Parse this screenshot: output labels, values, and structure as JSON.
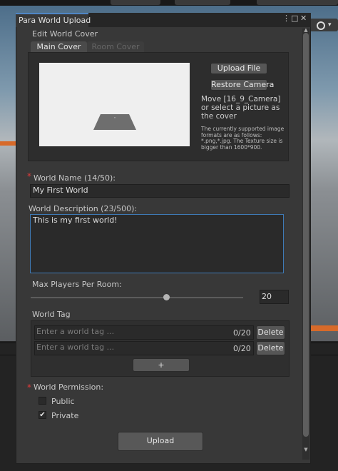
{
  "window": {
    "title": "Para World Upload",
    "menu_icon": "⋮",
    "maximize_icon": "□",
    "close_icon": "✕"
  },
  "cover": {
    "section_label": "Edit World Cover",
    "tabs": [
      {
        "label": "Main Cover",
        "active": true
      },
      {
        "label": "Room Cover",
        "active": false
      }
    ],
    "upload_file_label": "Upload File",
    "restore_camera_label": "Restore Camera",
    "info": "Move [16_9_Camera] or select a picture as the cover",
    "formats_info": "The currently supported image formats are as follows: *.png,*.jpg. The Texture size is bigger than 1600*900."
  },
  "world_name": {
    "label": "World Name (14/50):",
    "required_mark": "*",
    "value": "My First World"
  },
  "world_description": {
    "label": "World Description (23/500):",
    "value": "This is my first world!"
  },
  "max_players": {
    "label": "Max Players Per Room:",
    "value": "20",
    "slider_fraction": 0.64
  },
  "world_tag": {
    "label": "World Tag",
    "tags": [
      {
        "placeholder": "Enter a world tag ...",
        "count": "0/20",
        "delete_label": "Delete"
      },
      {
        "placeholder": "Enter a world tag ...",
        "count": "0/20",
        "delete_label": "Delete"
      }
    ],
    "add_label": "+"
  },
  "permission": {
    "label": "World Permission:",
    "required_mark": "*",
    "options": [
      {
        "label": "Public",
        "checked": false
      },
      {
        "label": "Private",
        "checked": true
      }
    ],
    "check_mark": "✔"
  },
  "upload_label": "Upload",
  "colors": {
    "accent": "#4f86c6",
    "required": "#e03b3b",
    "panel": "#383838"
  }
}
